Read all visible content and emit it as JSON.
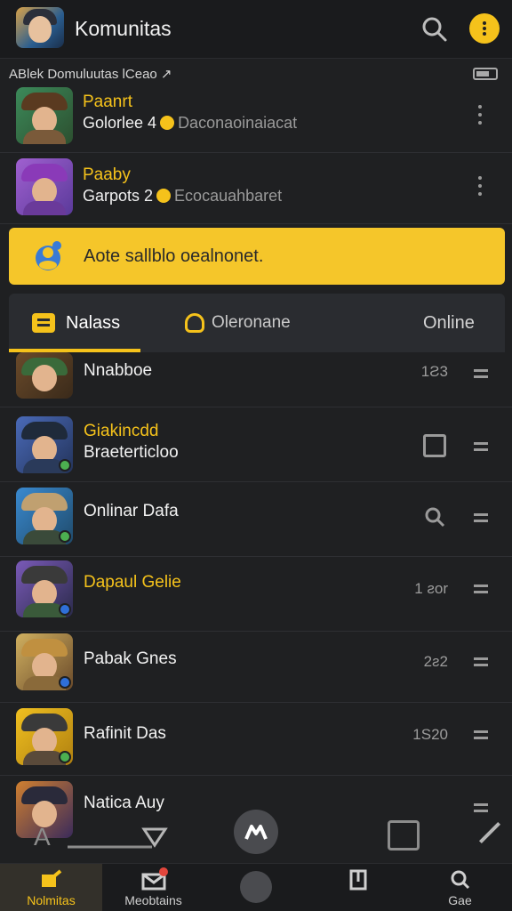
{
  "header": {
    "title": "Komunitas"
  },
  "subbar": {
    "text": "ABlek Domuluutas lCeao ↗"
  },
  "pinned": [
    {
      "name": "Paanrt",
      "sub_left": "Golorlee 4",
      "sub_right": "Daconaoinaiacat"
    },
    {
      "name": "Paaby",
      "sub_left": "Garpots 2",
      "sub_right": "Ecocauahbaret"
    }
  ],
  "banner": {
    "text": "Aote sallblo oealnonet."
  },
  "tabs": [
    {
      "label": "Nalass"
    },
    {
      "label": "Oleronane"
    },
    {
      "label": "Online"
    }
  ],
  "list": [
    {
      "title": "Nnabboe",
      "count": "1Ƨ3"
    },
    {
      "title": "Giakincdd",
      "subtitle": "Braeterticloo"
    },
    {
      "title": "Onlinar Dafa"
    },
    {
      "title": "Dapaul Gelie",
      "count": "1 ƨor"
    },
    {
      "title": "Pabak Gnes",
      "count": "2ƨ2"
    },
    {
      "title": "Rafinit Das",
      "count": "1S20"
    },
    {
      "title": "Natica Auy"
    }
  ],
  "nav": [
    {
      "label": "Nolmitas"
    },
    {
      "label": "Meobtains"
    },
    {
      "label": ""
    },
    {
      "label": ""
    },
    {
      "label": "Gae"
    }
  ]
}
